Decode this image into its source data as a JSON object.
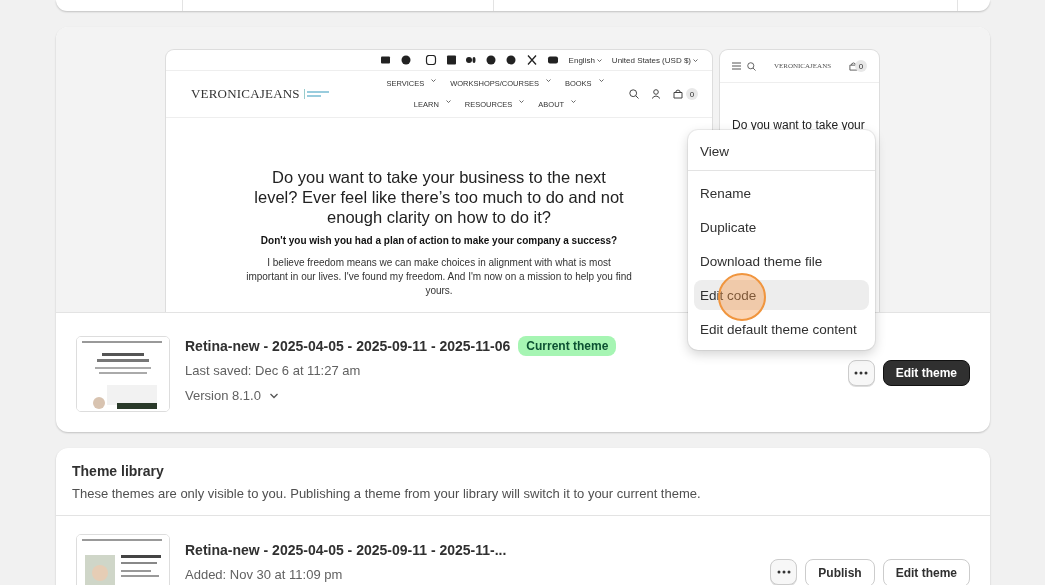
{
  "preview": {
    "desktop": {
      "language": "English",
      "currency": "United States (USD $)",
      "logo": "VERONICAJEANS",
      "nav": [
        "SERVICES",
        "WORKSHOPS/COURSES",
        "BOOKS",
        "LEARN",
        "RESOURCES",
        "ABOUT"
      ],
      "cart_count": "0",
      "headline": "Do you want to take your business to the next level? Ever feel like there’s too much to do and not enough clarity on how to do it?",
      "subheading": "Don't you wish you had a plan of action to make your company a success?",
      "body": "I believe freedom means we can make choices in alignment with what is most important in our lives. I've found my freedom. And I'm now on a mission to help you find yours."
    },
    "mobile": {
      "logo": "VERONICAJEANS",
      "cart_count": "0",
      "headline": "Do you want to take your"
    }
  },
  "current_theme": {
    "name": "Retina-new - 2025-04-05 - 2025-09-11 - 2025-11-06",
    "badge": "Current theme",
    "last_saved": "Last saved: Dec 6 at 11:27 am",
    "version": "Version 8.1.0",
    "edit_button": "Edit theme"
  },
  "menu": {
    "items": [
      {
        "label": "View",
        "highlighted": false,
        "divider_after": true
      },
      {
        "label": "Rename",
        "highlighted": false,
        "divider_after": false
      },
      {
        "label": "Duplicate",
        "highlighted": false,
        "divider_after": false
      },
      {
        "label": "Download theme file",
        "highlighted": false,
        "divider_after": false
      },
      {
        "label": "Edit code",
        "highlighted": true,
        "divider_after": false
      },
      {
        "label": "Edit default theme content",
        "highlighted": false,
        "divider_after": false
      }
    ]
  },
  "library": {
    "title": "Theme library",
    "description": "These themes are only visible to you. Publishing a theme from your library will switch it to your current theme.",
    "themes": [
      {
        "name": "Retina-new - 2025-04-05 - 2025-09-11 - 2025-11-...",
        "added": "Added: Nov 30 at 11:09 pm",
        "buttons": [
          "Publish",
          "Edit theme"
        ]
      }
    ]
  }
}
